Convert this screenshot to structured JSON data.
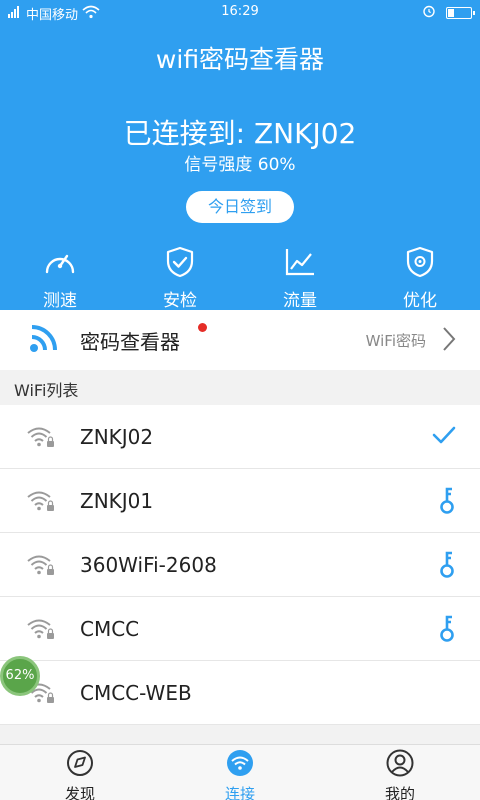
{
  "status_bar": {
    "carrier": "中国移动",
    "time": "16:29"
  },
  "header": {
    "app_title": "wifi密码查看器",
    "connected_text": "已连接到: ZNKJ02",
    "signal_text": "信号强度 60%",
    "checkin_label": "今日签到"
  },
  "tools": [
    {
      "label": "测速",
      "icon": "speedometer-icon"
    },
    {
      "label": "安检",
      "icon": "shield-check-icon"
    },
    {
      "label": "流量",
      "icon": "chart-line-icon"
    },
    {
      "label": "优化",
      "icon": "shield-gear-icon"
    }
  ],
  "password_row": {
    "label": "密码查看器",
    "right_text": "WiFi密码"
  },
  "wifi_section_title": "WiFi列表",
  "wifi_list": [
    {
      "name": "ZNKJ02",
      "action": "check-icon"
    },
    {
      "name": "ZNKJ01",
      "action": "key-icon"
    },
    {
      "name": "360WiFi-2608",
      "action": "key-icon"
    },
    {
      "name": "CMCC",
      "action": "key-icon"
    },
    {
      "name": "CMCC-WEB",
      "action": ""
    }
  ],
  "badge_text": "62%",
  "tabs": [
    {
      "label": "发现",
      "icon": "compass-icon",
      "active": false
    },
    {
      "label": "连接",
      "icon": "wifi-icon",
      "active": true
    },
    {
      "label": "我的",
      "icon": "user-icon",
      "active": false
    }
  ],
  "colors": {
    "primary": "#2f9ff0",
    "accent_red": "#e52d27",
    "badge_green": "#5aa54a"
  }
}
